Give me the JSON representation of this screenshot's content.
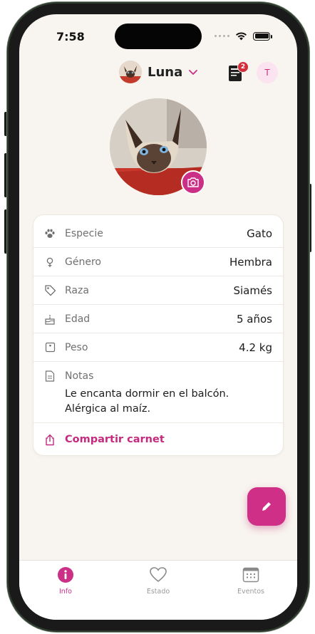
{
  "status_bar": {
    "time": "7:58"
  },
  "header": {
    "pet_name": "Luna",
    "documents_badge": "2",
    "user_initial": "T"
  },
  "info": {
    "rows": [
      {
        "label": "Especie",
        "value": "Gato",
        "icon": "paw-icon"
      },
      {
        "label": "Género",
        "value": "Hembra",
        "icon": "female-icon"
      },
      {
        "label": "Raza",
        "value": "Siamés",
        "icon": "tag-icon"
      },
      {
        "label": "Edad",
        "value": "5 años",
        "icon": "cake-icon"
      },
      {
        "label": "Peso",
        "value": "4.2 kg",
        "icon": "scale-icon"
      }
    ],
    "notes_label": "Notas",
    "notes_line1": "Le encanta dormir en el balcón.",
    "notes_line2": "Alérgica al maíz.",
    "share_label": "Compartir carnet"
  },
  "tabs": [
    {
      "label": "Info",
      "icon": "info-icon",
      "active": true
    },
    {
      "label": "Estado",
      "icon": "heart-icon",
      "active": false
    },
    {
      "label": "Eventos",
      "icon": "calendar-icon",
      "active": false
    }
  ],
  "colors": {
    "accent": "#cc2f86",
    "background": "#f8f4ef",
    "badge": "#d42e3a"
  }
}
